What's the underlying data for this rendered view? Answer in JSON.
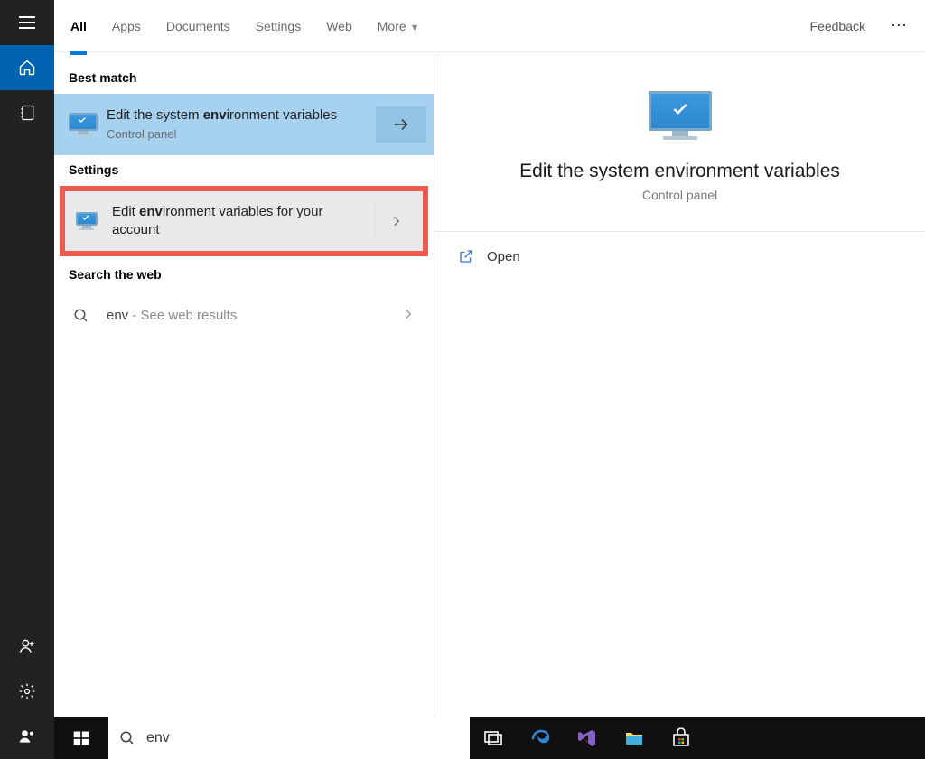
{
  "tabs": {
    "all": "All",
    "apps": "Apps",
    "documents": "Documents",
    "settings": "Settings",
    "web": "Web",
    "more": "More",
    "feedback": "Feedback"
  },
  "sections": {
    "best_match": "Best match",
    "settings": "Settings",
    "search_web": "Search the web"
  },
  "best": {
    "pre": "Edit the system ",
    "bold": "env",
    "post": "ironment variables",
    "sub": "Control panel"
  },
  "setting_item": {
    "pre": "Edit ",
    "bold": "env",
    "post": "ironment variables for your account"
  },
  "web_item": {
    "term": "env",
    "suffix": " - See web results"
  },
  "preview": {
    "title": "Edit the system environment variables",
    "sub": "Control panel",
    "open": "Open"
  },
  "search_value": "env",
  "colors": {
    "accent": "#0078D4",
    "highlight_border": "#EF5A4C",
    "best_bg": "#A6D2F0"
  }
}
